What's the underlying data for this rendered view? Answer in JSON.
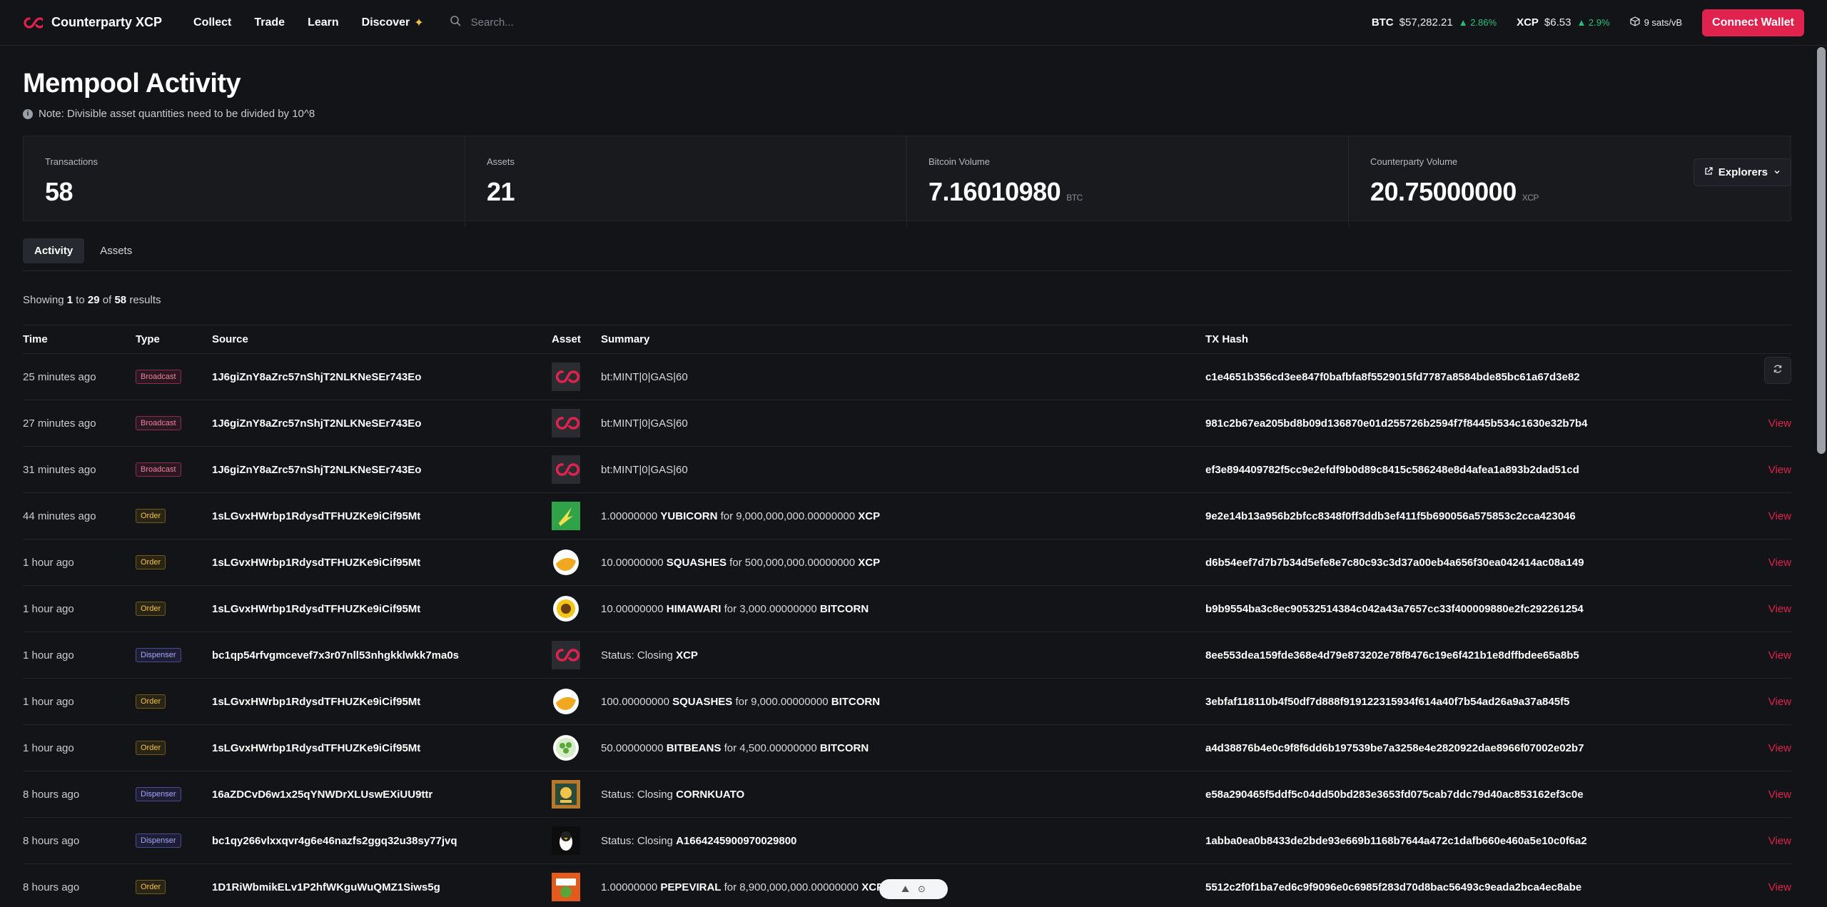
{
  "brand": {
    "name": "Counterparty XCP",
    "accent": "#e0224e"
  },
  "nav": [
    "Collect",
    "Trade",
    "Learn",
    "Discover"
  ],
  "search": {
    "placeholder": "Search..."
  },
  "tickers": [
    {
      "symbol": "BTC",
      "price": "$57,282.21",
      "change": "▲ 2.86%"
    },
    {
      "symbol": "XCP",
      "price": "$6.53",
      "change": "▲ 2.9%"
    }
  ],
  "fee": "9 sats/vB",
  "connect_label": "Connect Wallet",
  "page": {
    "title": "Mempool Activity",
    "note": "Note: Divisible asset quantities need to be divided by 10^8",
    "explorers_label": "Explorers"
  },
  "stats": [
    {
      "label": "Transactions",
      "value": "58",
      "unit": ""
    },
    {
      "label": "Assets",
      "value": "21",
      "unit": ""
    },
    {
      "label": "Bitcoin Volume",
      "value": "7.16010980",
      "unit": "BTC"
    },
    {
      "label": "Counterparty Volume",
      "value": "20.75000000",
      "unit": "XCP"
    }
  ],
  "tabs": [
    "Activity",
    "Assets"
  ],
  "showing": {
    "prefix": "Showing",
    "from": "1",
    "to_word": "to",
    "to": "29",
    "of_word": "of",
    "total": "58",
    "suffix": "results"
  },
  "table": {
    "headers": [
      "Time",
      "Type",
      "Source",
      "Asset",
      "Summary",
      "TX Hash",
      ""
    ],
    "rows": [
      {
        "time": "25 minutes ago",
        "type": "Broadcast",
        "source": "1J6giZnY8aZrc57nShjT2NLKNeSEr743Eo",
        "icon": "xcp-logo-icon",
        "summary": [
          [
            "t",
            "bt:MINT|0|GAS|60"
          ]
        ],
        "hash": "c1e4651b356cd3ee847f0bafbfa8f5529015fd7787a8584bde85bc61a67d3e82",
        "view": "View"
      },
      {
        "time": "27 minutes ago",
        "type": "Broadcast",
        "source": "1J6giZnY8aZrc57nShjT2NLKNeSEr743Eo",
        "icon": "xcp-logo-icon",
        "summary": [
          [
            "t",
            "bt:MINT|0|GAS|60"
          ]
        ],
        "hash": "981c2b67ea205bd8b09d136870e01d255726b2594f7f8445b534c1630e32b7b4",
        "view": "View"
      },
      {
        "time": "31 minutes ago",
        "type": "Broadcast",
        "source": "1J6giZnY8aZrc57nShjT2NLKNeSEr743Eo",
        "icon": "xcp-logo-icon",
        "summary": [
          [
            "t",
            "bt:MINT|0|GAS|60"
          ]
        ],
        "hash": "ef3e894409782f5cc9e2efdf9b0d89c8415c586248e8d4afea1a893b2dad51cd",
        "view": "View"
      },
      {
        "time": "44 minutes ago",
        "type": "Order",
        "source": "1sLGvxHWrbp1RdysdTFHUZKe9iCif95Mt",
        "icon": "yubicorn-icon",
        "summary": [
          [
            "t",
            "1.00000000 "
          ],
          [
            "b",
            "YUBICORN"
          ],
          [
            "t",
            " for 9,000,000,000.00000000 "
          ],
          [
            "b",
            "XCP"
          ]
        ],
        "hash": "9e2e14b13a956b2bfcc8348f0ff3ddb3ef411f5b690056a575853c2cca423046",
        "view": "View"
      },
      {
        "time": "1 hour ago",
        "type": "Order",
        "source": "1sLGvxHWrbp1RdysdTFHUZKe9iCif95Mt",
        "icon": "squashes-icon",
        "summary": [
          [
            "t",
            "10.00000000 "
          ],
          [
            "b",
            "SQUASHES"
          ],
          [
            "t",
            " for 500,000,000.00000000 "
          ],
          [
            "b",
            "XCP"
          ]
        ],
        "hash": "d6b54eef7d7b7b34d5efe8e7c80c93c3d37a00eb4a656f30ea042414ac08a149",
        "view": "View"
      },
      {
        "time": "1 hour ago",
        "type": "Order",
        "source": "1sLGvxHWrbp1RdysdTFHUZKe9iCif95Mt",
        "icon": "himawari-icon",
        "summary": [
          [
            "t",
            "10.00000000 "
          ],
          [
            "b",
            "HIMAWARI"
          ],
          [
            "t",
            " for 3,000.00000000 "
          ],
          [
            "b",
            "BITCORN"
          ]
        ],
        "hash": "b9b9554ba3c8ec90532514384c042a43a7657cc33f400009880e2fc292261254",
        "view": "View"
      },
      {
        "time": "1 hour ago",
        "type": "Dispenser",
        "source": "bc1qp54rfvgmcevef7x3r07nll53nhgkklwkk7ma0s",
        "icon": "xcp-logo-icon",
        "summary": [
          [
            "t",
            "Status: Closing "
          ],
          [
            "b",
            "XCP"
          ]
        ],
        "hash": "8ee553dea159fde368e4d79e873202e78f8476c19e6f421b1e8dffbdee65a8b5",
        "view": "View"
      },
      {
        "time": "1 hour ago",
        "type": "Order",
        "source": "1sLGvxHWrbp1RdysdTFHUZKe9iCif95Mt",
        "icon": "squashes-icon",
        "summary": [
          [
            "t",
            "100.00000000 "
          ],
          [
            "b",
            "SQUASHES"
          ],
          [
            "t",
            " for 9,000.00000000 "
          ],
          [
            "b",
            "BITCORN"
          ]
        ],
        "hash": "3ebfaf118110b4f50df7d888f919122315934f614a40f7b54ad26a9a37a845f5",
        "view": "View"
      },
      {
        "time": "1 hour ago",
        "type": "Order",
        "source": "1sLGvxHWrbp1RdysdTFHUZKe9iCif95Mt",
        "icon": "bitbeans-icon",
        "summary": [
          [
            "t",
            "50.00000000 "
          ],
          [
            "b",
            "BITBEANS"
          ],
          [
            "t",
            " for 4,500.00000000 "
          ],
          [
            "b",
            "BITCORN"
          ]
        ],
        "hash": "a4d38876b4e0c9f8f6dd6b197539be7a3258e4e2820922dae8966f07002e02b7",
        "view": "View"
      },
      {
        "time": "8 hours ago",
        "type": "Dispenser",
        "source": "16aZDCvD6w1x25qYNWDrXLUswEXiUU9ttr",
        "icon": "cornkuato-icon",
        "summary": [
          [
            "t",
            "Status: Closing "
          ],
          [
            "b",
            "CORNKUATO"
          ]
        ],
        "hash": "e58a290465f5ddf5c04dd50bd283e3653fd075cab7ddc79d40ac853162ef3c0e",
        "view": "View"
      },
      {
        "time": "8 hours ago",
        "type": "Dispenser",
        "source": "bc1qy266vlxxqvr4g6e46nazfs2ggq32u38sy77jvq",
        "icon": "penguin-icon",
        "summary": [
          [
            "t",
            "Status: Closing "
          ],
          [
            "b",
            "A1664245900970029800"
          ]
        ],
        "hash": "1abba0ea0b8433de2bde93e669b1168b7644a472c1dafb660e460a5e10c0f6a2",
        "view": "View"
      },
      {
        "time": "8 hours ago",
        "type": "Order",
        "source": "1D1RiWbmikELv1P2hfWKguWuQMZ1Siws5g",
        "icon": "pepeviral-icon",
        "summary": [
          [
            "t",
            "1.00000000 "
          ],
          [
            "b",
            "PEPEVIRAL"
          ],
          [
            "t",
            " for 8,900,000,000.00000000 "
          ],
          [
            "b",
            "XCP"
          ]
        ],
        "hash": "5512c2f0f1ba7ed6c9f9096e0c6985f283d70d8bac56493c9eada2bca4ec8abe",
        "view": "View"
      }
    ]
  }
}
